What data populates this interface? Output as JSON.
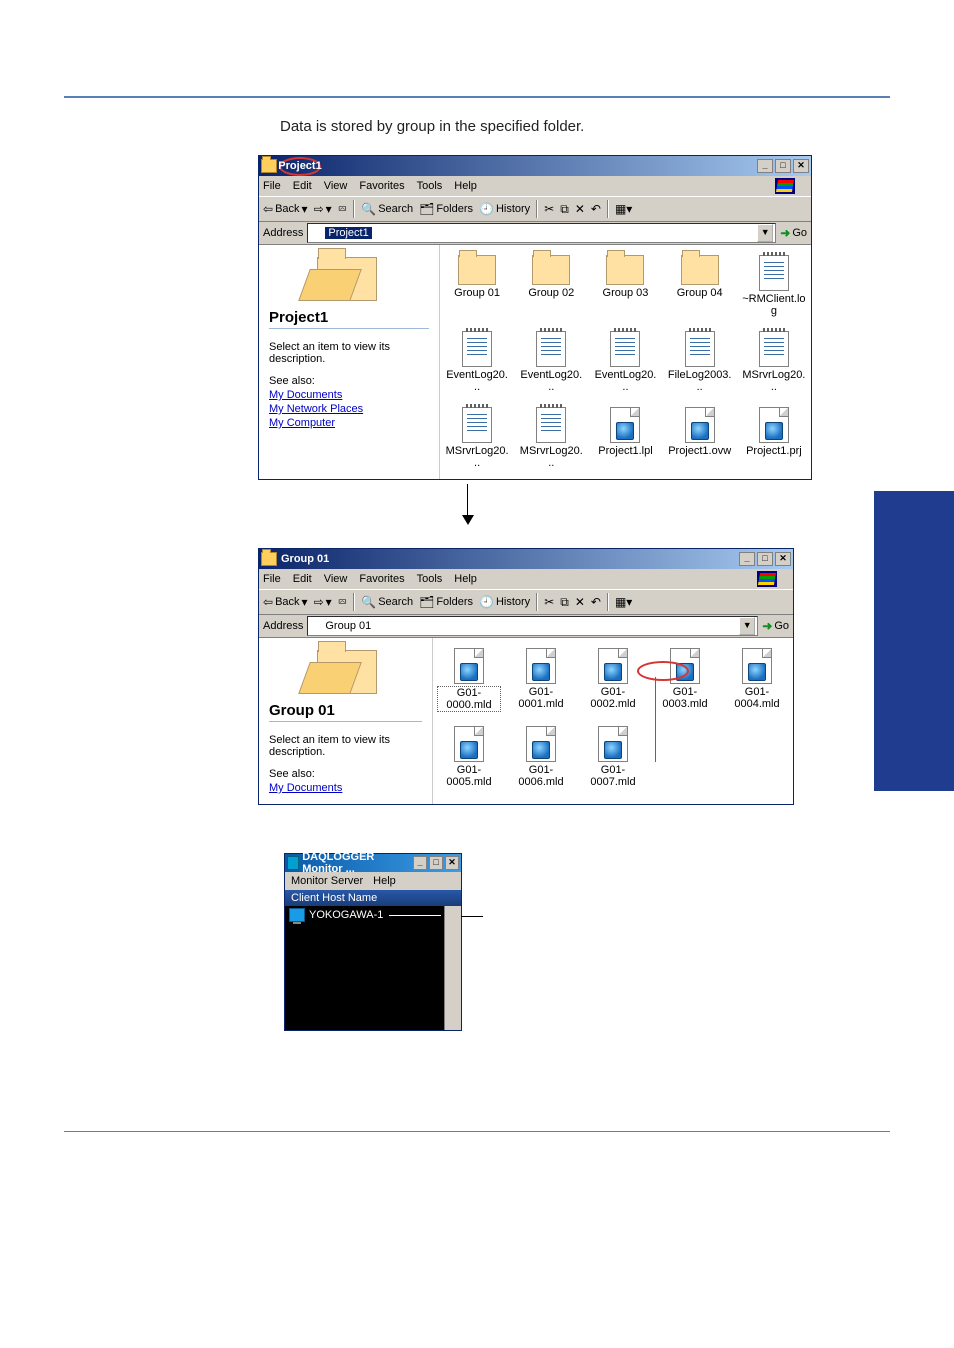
{
  "page": {
    "intro_text": "Data is stored by group in the specified folder."
  },
  "explorer1": {
    "title": "Project1",
    "menu": {
      "file": "File",
      "edit": "Edit",
      "view": "View",
      "favorites": "Favorites",
      "tools": "Tools",
      "help": "Help"
    },
    "toolbar": {
      "back": "Back",
      "search": "Search",
      "folders": "Folders",
      "history": "History"
    },
    "address_label": "Address",
    "address_value": "Project1",
    "go": "Go",
    "sidebar": {
      "title": "Project1",
      "desc": "Select an item to view its description.",
      "see_also": "See also:",
      "links": [
        "My Documents",
        "My Network Places",
        "My Computer"
      ]
    },
    "files": [
      [
        "Group 01",
        "Group 02",
        "Group 03",
        "Group 04",
        "~RMClient.log"
      ],
      [
        "EventLog20...",
        "EventLog20...",
        "EventLog20...",
        "FileLog2003...",
        "MSrvrLog20..."
      ],
      [
        "MSrvrLog20...",
        "MSrvrLog20...",
        "Project1.lpl",
        "Project1.ovw",
        "Project1.prj"
      ]
    ]
  },
  "explorer2": {
    "title": "Group 01",
    "menu": {
      "file": "File",
      "edit": "Edit",
      "view": "View",
      "favorites": "Favorites",
      "tools": "Tools",
      "help": "Help"
    },
    "toolbar": {
      "back": "Back",
      "search": "Search",
      "folders": "Folders",
      "history": "History"
    },
    "address_label": "Address",
    "address_value": "Group 01",
    "go": "Go",
    "sidebar": {
      "title": "Group 01",
      "desc": "Select an item to view its description.",
      "see_also": "See also:",
      "links": [
        "My Documents"
      ]
    },
    "files": [
      [
        "G01-0000.mld",
        "G01-0001.mld",
        "G01-0002.mld",
        "G01-0003.mld",
        "G01-0004.mld"
      ],
      [
        "G01-0005.mld",
        "G01-0006.mld",
        "G01-0007.mld"
      ]
    ]
  },
  "monitor": {
    "title": "DAQLOGGER Monitor ...",
    "menu": {
      "server": "Monitor Server",
      "help": "Help"
    },
    "column_header": "Client Host Name",
    "host": "YOKOGAWA-1"
  }
}
